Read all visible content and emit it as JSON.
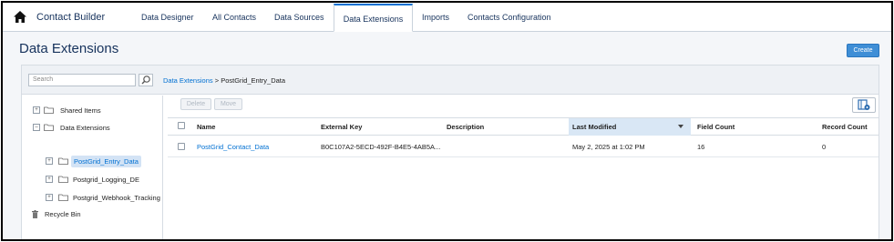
{
  "app": {
    "title": "Contact Builder"
  },
  "nav": {
    "tabs": [
      {
        "label": "Data Designer"
      },
      {
        "label": "All Contacts"
      },
      {
        "label": "Data Sources"
      },
      {
        "label": "Data Extensions",
        "active": true
      },
      {
        "label": "Imports"
      },
      {
        "label": "Contacts Configuration"
      }
    ]
  },
  "page": {
    "title": "Data Extensions",
    "create_label": "Create"
  },
  "search": {
    "placeholder": "Search"
  },
  "breadcrumb": {
    "root": "Data Extensions",
    "separator": " > ",
    "current": "PostGrid_Entry_Data"
  },
  "tree": {
    "items": [
      {
        "label": "Shared Items",
        "icon": "folder-icon",
        "expander": "+"
      },
      {
        "label": "Data Extensions",
        "icon": "folder-icon",
        "expander": "–"
      },
      {
        "label": "PostGrid_Entry_Data",
        "icon": "folder-icon",
        "expander": "+",
        "selected": true
      },
      {
        "label": "Postgrid_Logging_DE",
        "icon": "folder-icon",
        "expander": "+"
      },
      {
        "label": "Postgrid_Webhook_Tracking",
        "icon": "folder-icon",
        "expander": "+"
      },
      {
        "label": "Recycle Bin",
        "icon": "trash-icon"
      }
    ]
  },
  "toolbar": {
    "delete_label": "Delete",
    "move_label": "Move"
  },
  "table": {
    "columns": [
      "Name",
      "External Key",
      "Description",
      "Last Modified",
      "Field Count",
      "Record Count"
    ],
    "sorted_column": "Last Modified",
    "rows": [
      {
        "name": "PostGrid_Contact_Data",
        "external_key": "B0C107A2-5ECD-492F-B4E5-4AB5A...",
        "description": "",
        "last_modified": "May 2, 2025 at 1:02 PM",
        "field_count": "16",
        "record_count": "0"
      }
    ]
  },
  "colors": {
    "accent": "#0070d2",
    "nav_text": "#16325c",
    "create_button": "#3f8ed6",
    "sorted_header": "#d9e7f5"
  }
}
